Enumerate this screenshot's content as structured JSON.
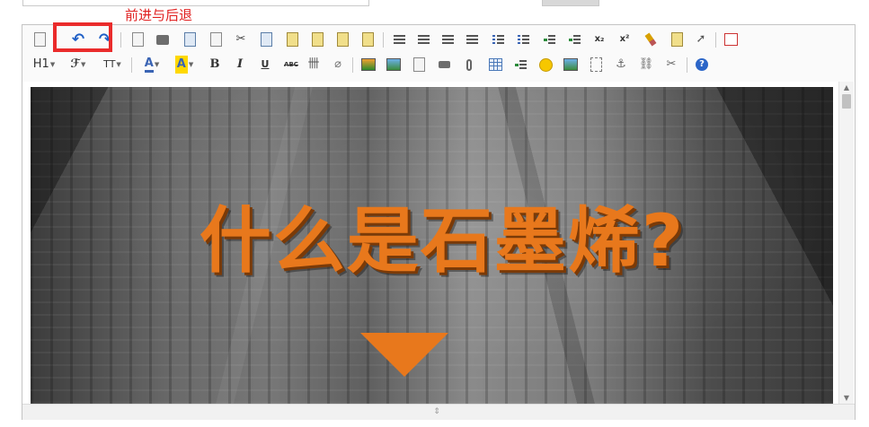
{
  "annotation": {
    "text": "前进与后退"
  },
  "toolbar": {
    "row1": {
      "source": "源代码",
      "undo": "↶",
      "redo": "↷",
      "cut": "✂",
      "superscript_label": "x²",
      "subscript_label": "x₂"
    },
    "row2": {
      "heading": "H1",
      "font_family": "ℱ",
      "font_size": "TT",
      "font_color": "A",
      "bg_color": "A",
      "bold": "B",
      "italic": "I",
      "underline": "U",
      "strikethrough": "ABC",
      "align_table": "卌",
      "clear": "⌀",
      "help": "?",
      "link": "⛓",
      "anchor": "⚓"
    }
  },
  "content": {
    "headline": "什么是石墨烯?"
  },
  "colors": {
    "accent_orange": "#e8781c",
    "annotation_red": "#e02020",
    "highlight_border": "#ea2b2b",
    "toolbar_blue": "#1f5fc6"
  }
}
